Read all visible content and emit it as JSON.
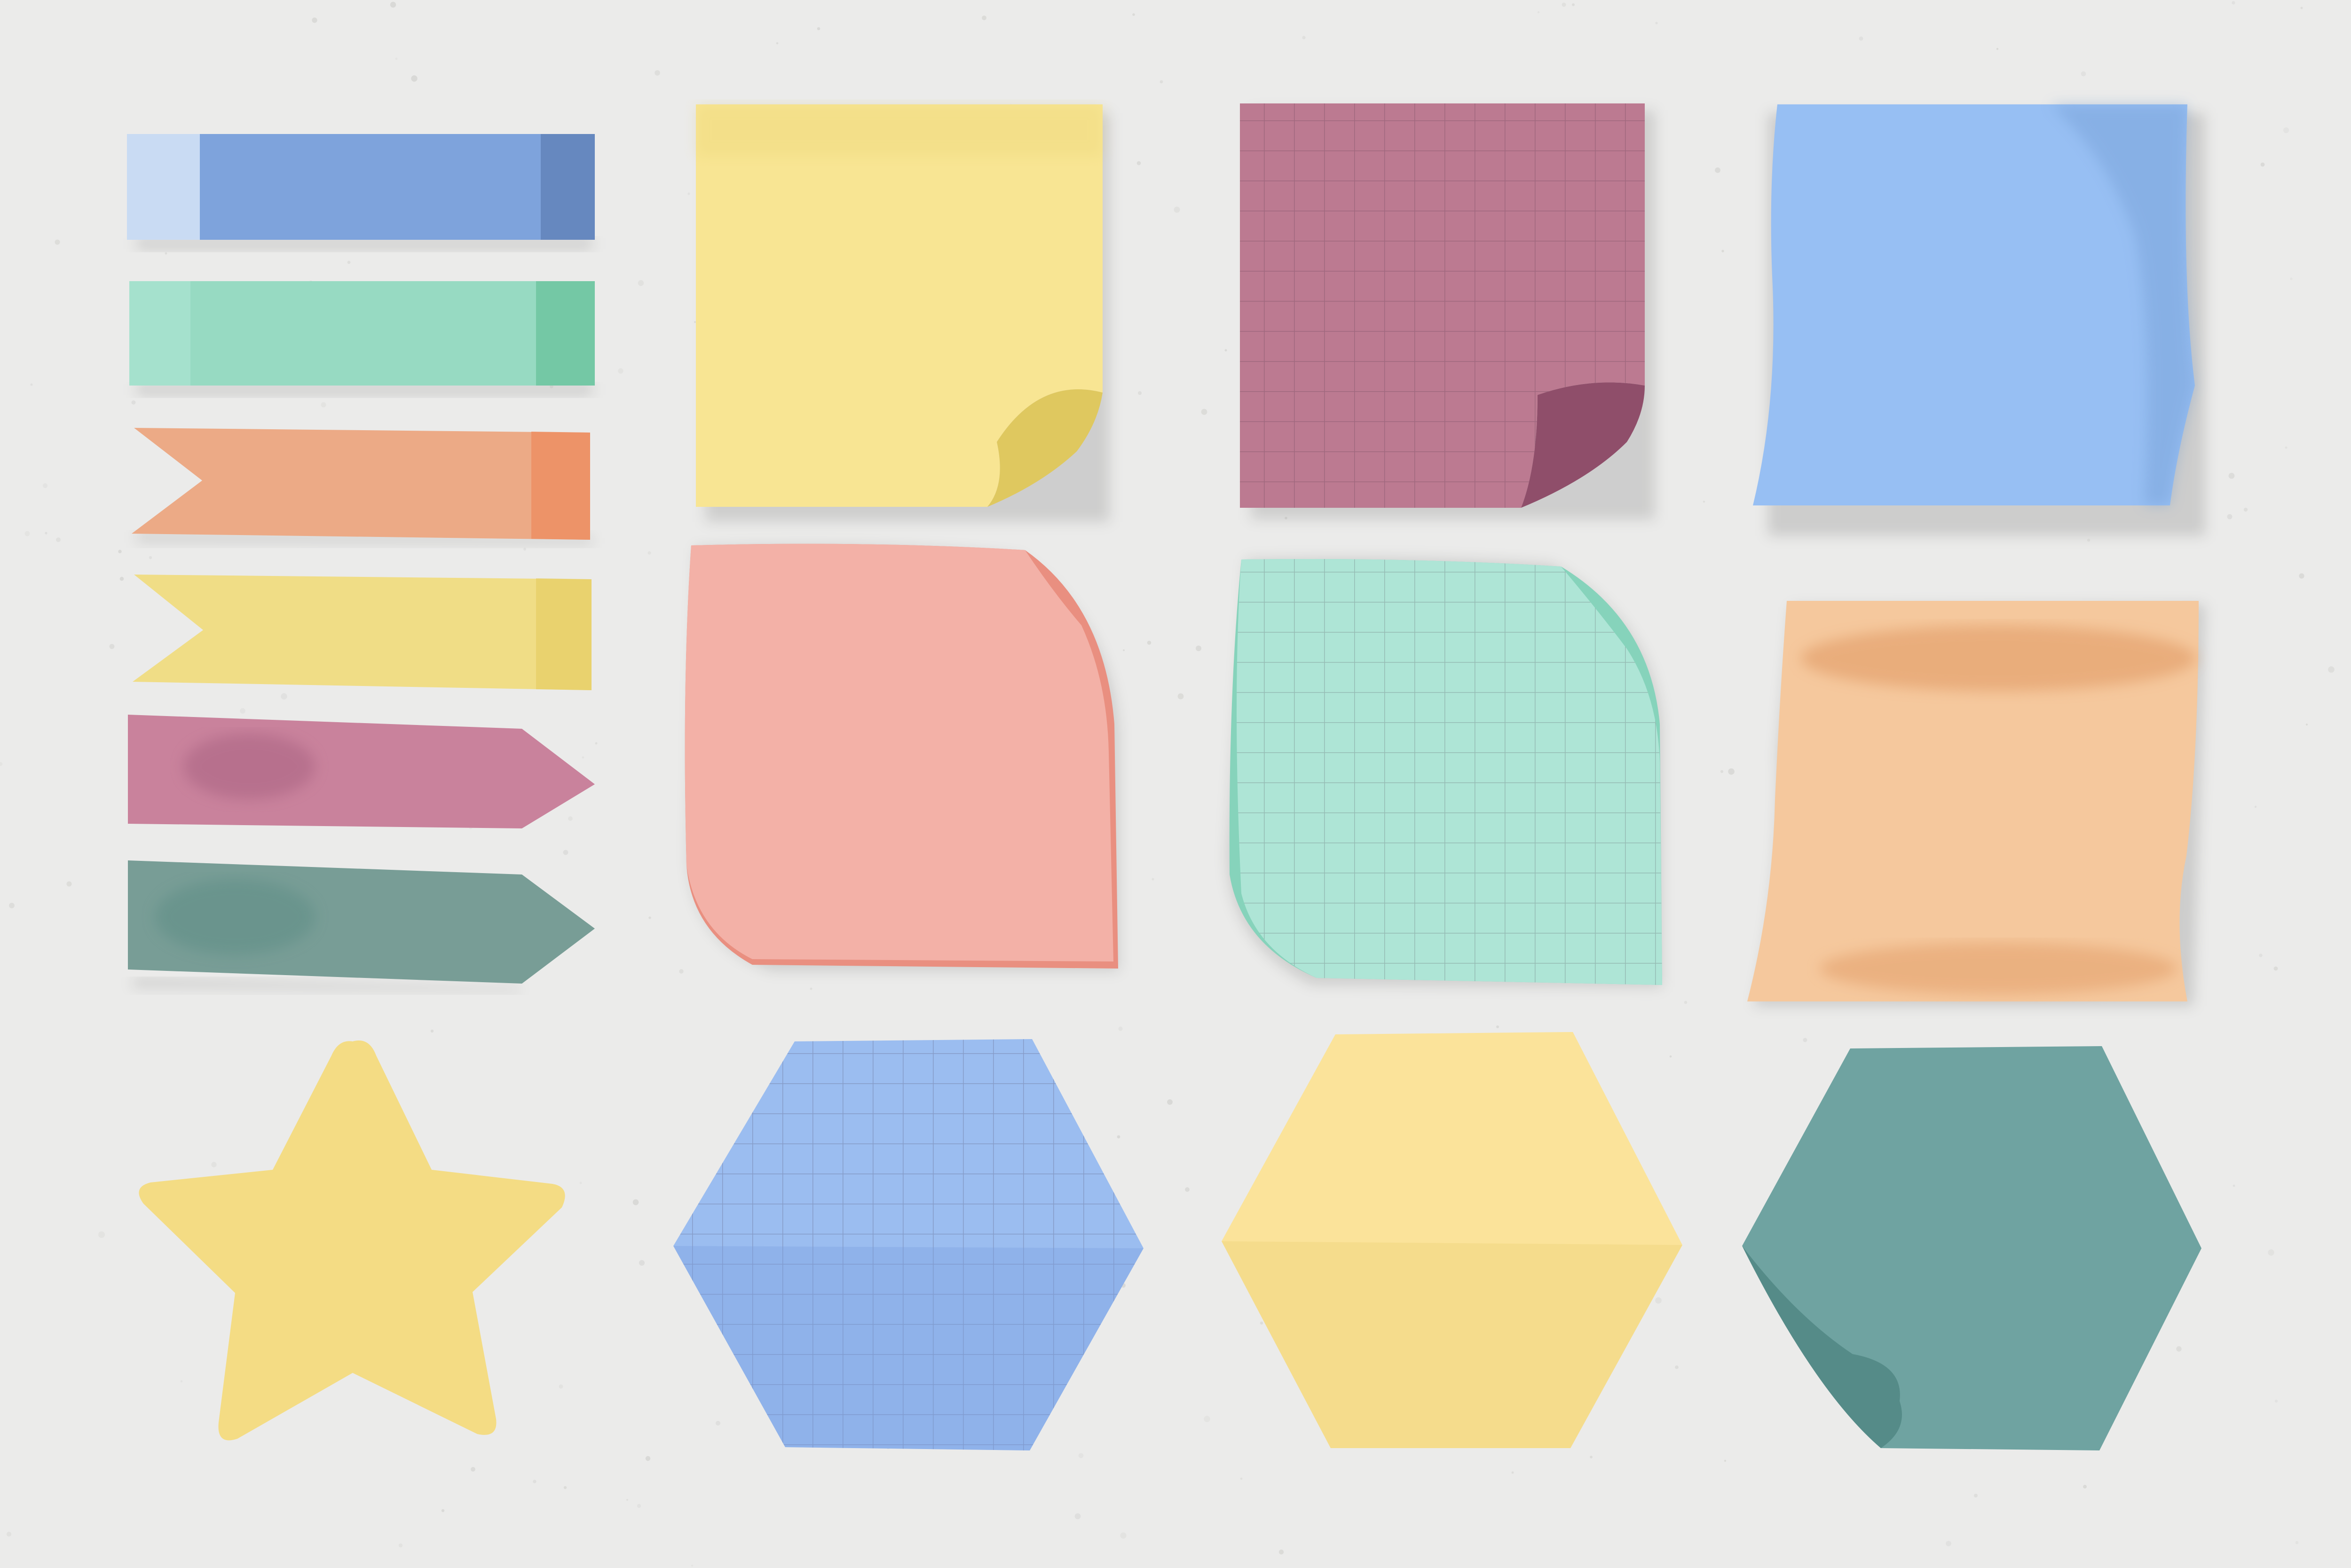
{
  "scene": {
    "background": "#ebebea",
    "speckle": "#cfcfcc",
    "shadow": "rgba(0,0,0,0.12)",
    "grid_line": "rgba(60,40,60,0.22)"
  },
  "tabs": [
    {
      "name": "tab-blue",
      "color": "#7ea3dc",
      "shade": "#5f7fb5",
      "tip": "#c9dbf3",
      "shape": "flat"
    },
    {
      "name": "tab-mint",
      "color": "#97dac2",
      "shade": "#6cc39d",
      "tip": "#a9e2cf",
      "shape": "flat"
    },
    {
      "name": "tab-orange",
      "color": "#ecaa86",
      "shade": "#ee8d60",
      "shape": "ribbon-notch"
    },
    {
      "name": "tab-yellow",
      "color": "#f0dd86",
      "shade": "#e5cc5f",
      "shape": "ribbon-notch"
    },
    {
      "name": "tab-pink",
      "color": "#c9829c",
      "shade": "#a96382",
      "shape": "arrow"
    },
    {
      "name": "tab-teal",
      "color": "#789d96",
      "shade": "#5f8e86",
      "shape": "arrow"
    }
  ],
  "notes": [
    {
      "name": "note-yellow-square",
      "color": "#f8e593",
      "shade": "#dfc85f",
      "grid": false,
      "curl": "bottom-right"
    },
    {
      "name": "note-purple-grid-square",
      "color": "#bc7a91",
      "shade": "#8f4e6a",
      "grid": true,
      "curl": "bottom-right"
    },
    {
      "name": "note-blue-square",
      "color": "#97bff3",
      "shade": "#6c95cc",
      "grid": false,
      "curl": "warped"
    },
    {
      "name": "note-coral-curl",
      "color": "#f3b1a7",
      "shade": "#e98f80",
      "grid": false,
      "curl": "rounded"
    },
    {
      "name": "note-mint-grid-curl",
      "color": "#aee5d6",
      "shade": "#86d3bb",
      "grid": true,
      "curl": "rounded"
    },
    {
      "name": "note-peach-warped",
      "color": "#f5c89d",
      "shade": "#e4a26e",
      "grid": false,
      "curl": "warped"
    },
    {
      "name": "note-yellow-star",
      "color": "#f4dc84",
      "shade": "#e8cc65",
      "grid": false,
      "curl": "none"
    },
    {
      "name": "note-blue-grid-hexagon",
      "color": "#9bbdf0",
      "shade": "#779edf",
      "grid": true,
      "curl": "none"
    },
    {
      "name": "note-yellow-hexagon",
      "color": "#fbe39a",
      "shade": "#ecce74",
      "grid": false,
      "curl": "none"
    },
    {
      "name": "note-teal-hexagon",
      "color": "#6fa3a1",
      "shade": "#558b88",
      "grid": false,
      "curl": "bottom-left"
    }
  ]
}
